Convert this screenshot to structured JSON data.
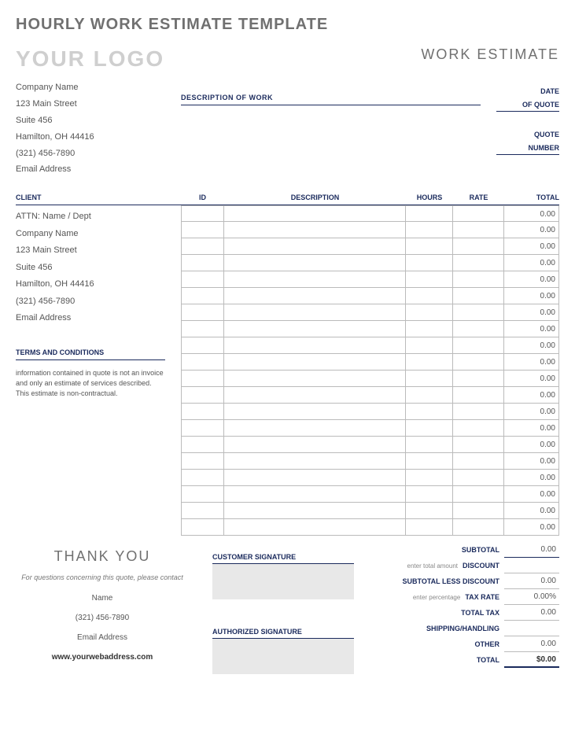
{
  "page_title": "HOURLY WORK ESTIMATE TEMPLATE",
  "logo_text": "YOUR LOGO",
  "doc_title": "WORK ESTIMATE",
  "company": {
    "name": "Company Name",
    "street": "123 Main Street",
    "suite": "Suite 456",
    "city": "Hamilton, OH  44416",
    "phone": "(321) 456-7890",
    "email": "Email Address"
  },
  "labels": {
    "description_of_work": "DESCRIPTION OF WORK",
    "date": "DATE",
    "of_quote": "OF QUOTE",
    "quote": "QUOTE",
    "number": "NUMBER",
    "client": "CLIENT",
    "id": "ID",
    "description": "DESCRIPTION",
    "hours": "HOURS",
    "rate": "RATE",
    "total": "TOTAL",
    "terms": "TERMS AND CONDITIONS",
    "customer_signature": "CUSTOMER SIGNATURE",
    "authorized_signature": "AUTHORIZED SIGNATURE"
  },
  "client": {
    "attn": "ATTN: Name / Dept",
    "name": "Company Name",
    "street": "123 Main Street",
    "suite": "Suite 456",
    "city": "Hamilton, OH  44416",
    "phone": "(321) 456-7890",
    "email": "Email Address"
  },
  "terms_text": "information contained in quote is not an invoice and only an estimate of services described. This estimate is non-contractual.",
  "line_items": [
    {
      "total": "0.00"
    },
    {
      "total": "0.00"
    },
    {
      "total": "0.00"
    },
    {
      "total": "0.00"
    },
    {
      "total": "0.00"
    },
    {
      "total": "0.00"
    },
    {
      "total": "0.00"
    },
    {
      "total": "0.00"
    },
    {
      "total": "0.00"
    },
    {
      "total": "0.00"
    },
    {
      "total": "0.00"
    },
    {
      "total": "0.00"
    },
    {
      "total": "0.00"
    },
    {
      "total": "0.00"
    },
    {
      "total": "0.00"
    },
    {
      "total": "0.00"
    },
    {
      "total": "0.00"
    },
    {
      "total": "0.00"
    },
    {
      "total": "0.00"
    },
    {
      "total": "0.00"
    }
  ],
  "thankyou": {
    "title": "THANK YOU",
    "sub": "For questions concerning this quote, please contact",
    "name": "Name",
    "phone": "(321) 456-7890",
    "email": "Email Address",
    "web": "www.yourwebaddress.com"
  },
  "totals": {
    "subtotal_label": "SUBTOTAL",
    "subtotal": "0.00",
    "discount_hint": "enter total amount",
    "discount_label": "DISCOUNT",
    "discount": "",
    "less_discount_label": "SUBTOTAL LESS DISCOUNT",
    "less_discount": "0.00",
    "taxrate_hint": "enter percentage",
    "taxrate_label": "TAX RATE",
    "taxrate": "0.00%",
    "totaltax_label": "TOTAL TAX",
    "totaltax": "0.00",
    "shipping_label": "SHIPPING/HANDLING",
    "shipping": "",
    "other_label": "OTHER",
    "other": "0.00",
    "total_label": "TOTAL",
    "total": "$0.00"
  }
}
